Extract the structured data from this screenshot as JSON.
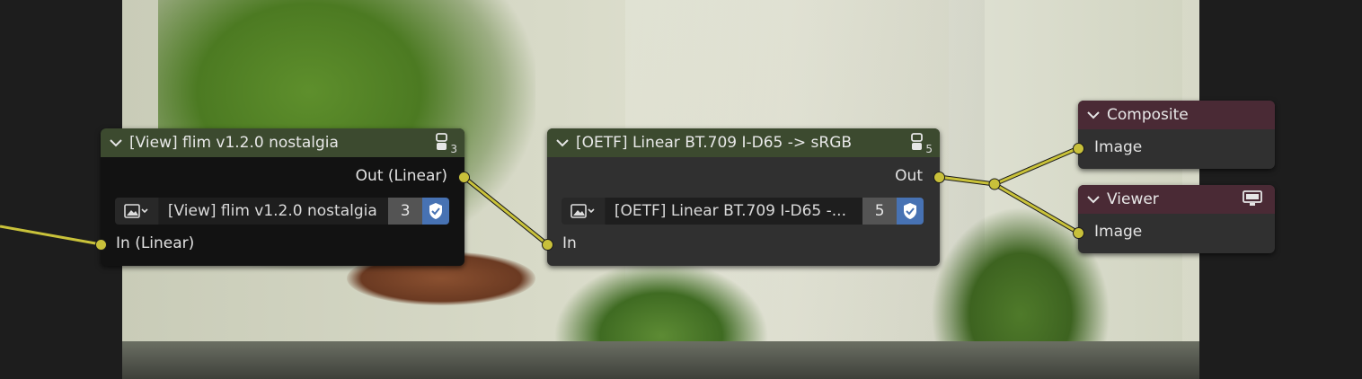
{
  "nodes": {
    "view_flim": {
      "title": "[View] flim v1.2.0 nostalgia",
      "group_users": "3",
      "output": "Out (Linear)",
      "input": "In (Linear)",
      "datablock_name": "[View] flim v1.2.0 nostalgia",
      "datablock_users": "3"
    },
    "oetf": {
      "title": "[OETF] Linear BT.709 I-D65 -> sRGB",
      "group_users": "5",
      "output": "Out",
      "input": "In",
      "datablock_name": "[OETF] Linear BT.709 I-D65 -...",
      "datablock_users": "5"
    },
    "composite": {
      "title": "Composite",
      "input": "Image"
    },
    "viewer": {
      "title": "Viewer",
      "input": "Image"
    }
  },
  "icons": [
    "chevron-down-icon",
    "node-group-icon",
    "image-datablock-icon",
    "fake-user-shield-icon",
    "monitor-icon"
  ],
  "colors": {
    "canvas": "#1d1d1d",
    "node_body": "#303030",
    "group_header": "#3c4a2f",
    "output_header": "#4a2a35",
    "socket": "#c8c03a",
    "link": "#c9c23a",
    "fake_user": "#4772b3"
  }
}
